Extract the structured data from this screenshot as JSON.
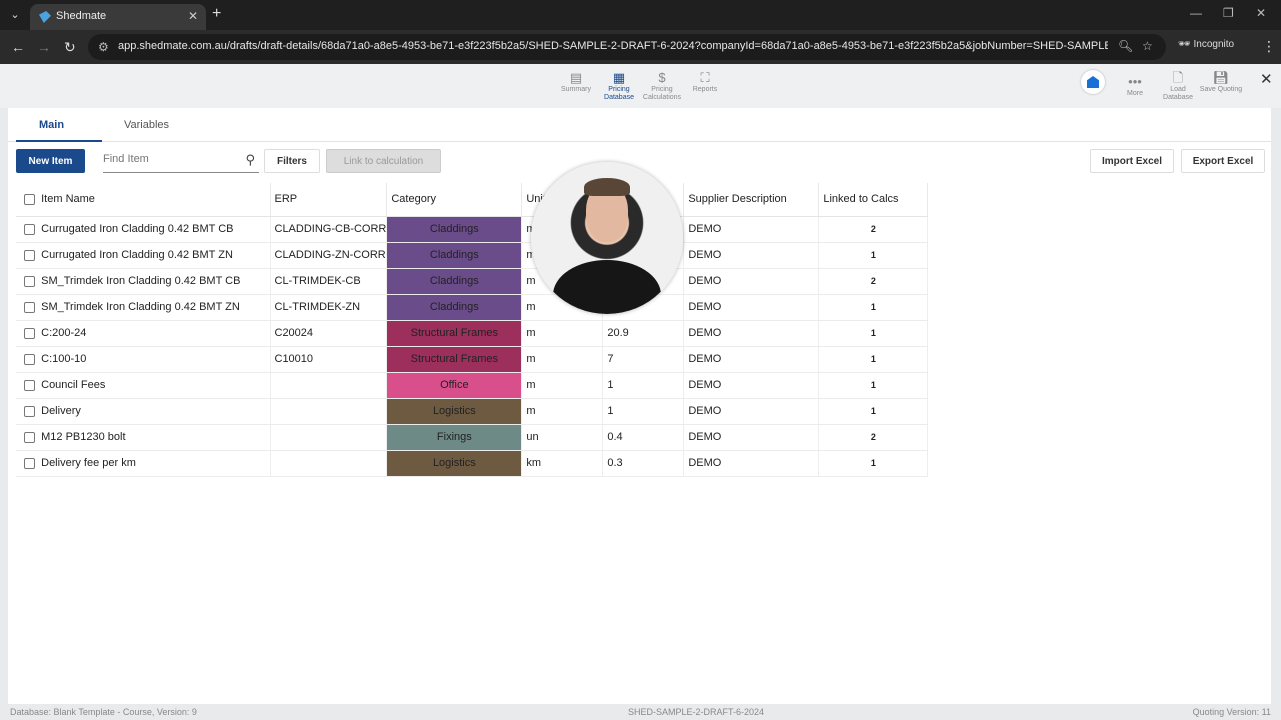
{
  "browser": {
    "tab_title": "Shedmate",
    "url": "app.shedmate.com.au/drafts/draft-details/68da71a0-a8e5-4953-be71-e3f223f5b2a5/SHED-SAMPLE-2-DRAFT-6-2024?companyId=68da71a0-a8e5-4953-be71-e3f223f5b2a5&jobNumber=SHED-SAMPLE-2-DRAFT...",
    "incognito_label": "Incognito"
  },
  "toolbar": {
    "summary": "Summary",
    "pricing_database": "Pricing Database",
    "pricing_calculations": "Pricing Calculations",
    "reports": "Reports",
    "more": "More",
    "load_database": "Load Database",
    "save_quoting": "Save Quoting"
  },
  "tabs": {
    "main": "Main",
    "variables": "Variables"
  },
  "actions": {
    "new_item": "New Item",
    "search_placeholder": "Find Item",
    "filters": "Filters",
    "link_to_calculation": "Link to calculation",
    "import_excel": "Import Excel",
    "export_excel": "Export Excel"
  },
  "table": {
    "headers": [
      "Item Name",
      "ERP",
      "Category",
      "Unit",
      "",
      "Supplier Description",
      "Linked to Calcs"
    ],
    "rows": [
      {
        "name": "Currugated Iron Cladding 0.42 BMT CB",
        "erp": "CLADDING-CB-CORR",
        "category": "Claddings",
        "color": "#6b4c8a",
        "unit": "m",
        "price": "",
        "supplier": "DEMO",
        "linked": "2"
      },
      {
        "name": "Currugated Iron Cladding 0.42 BMT ZN",
        "erp": "CLADDING-ZN-CORR",
        "category": "Claddings",
        "color": "#6b4c8a",
        "unit": "m",
        "price": "",
        "supplier": "DEMO",
        "linked": "1"
      },
      {
        "name": "SM_Trimdek Iron Cladding 0.42 BMT CB",
        "erp": "CL-TRIMDEK-CB",
        "category": "Claddings",
        "color": "#6b4c8a",
        "unit": "m",
        "price": "",
        "supplier": "DEMO",
        "linked": "2"
      },
      {
        "name": "SM_Trimdek Iron Cladding 0.42 BMT ZN",
        "erp": "CL-TRIMDEK-ZN",
        "category": "Claddings",
        "color": "#6b4c8a",
        "unit": "m",
        "price": "",
        "supplier": "DEMO",
        "linked": "1"
      },
      {
        "name": "C:200-24",
        "erp": "C20024",
        "category": "Structural Frames",
        "color": "#9c2f5c",
        "unit": "m",
        "price": "20.9",
        "supplier": "DEMO",
        "linked": "1"
      },
      {
        "name": "C:100-10",
        "erp": "C10010",
        "category": "Structural Frames",
        "color": "#9c2f5c",
        "unit": "m",
        "price": "7",
        "supplier": "DEMO",
        "linked": "1"
      },
      {
        "name": "Council Fees",
        "erp": "",
        "category": "Office",
        "color": "#d94f8c",
        "unit": "m",
        "price": "1",
        "supplier": "DEMO",
        "linked": "1"
      },
      {
        "name": "Delivery",
        "erp": "",
        "category": "Logistics",
        "color": "#6e5a40",
        "unit": "m",
        "price": "1",
        "supplier": "DEMO",
        "linked": "1"
      },
      {
        "name": "M12 PB1230 bolt",
        "erp": "",
        "category": "Fixings",
        "color": "#6e8a86",
        "unit": "un",
        "price": "0.4",
        "supplier": "DEMO",
        "linked": "2"
      },
      {
        "name": "Delivery fee per km",
        "erp": "",
        "category": "Logistics",
        "color": "#6e5a40",
        "unit": "km",
        "price": "0.3",
        "supplier": "DEMO",
        "linked": "1"
      }
    ]
  },
  "status": {
    "database": "Database: Blank Template - Course, Version: 9",
    "job": "SHED-SAMPLE-2-DRAFT-6-2024",
    "quoting_version": "Quoting Version: 11"
  }
}
